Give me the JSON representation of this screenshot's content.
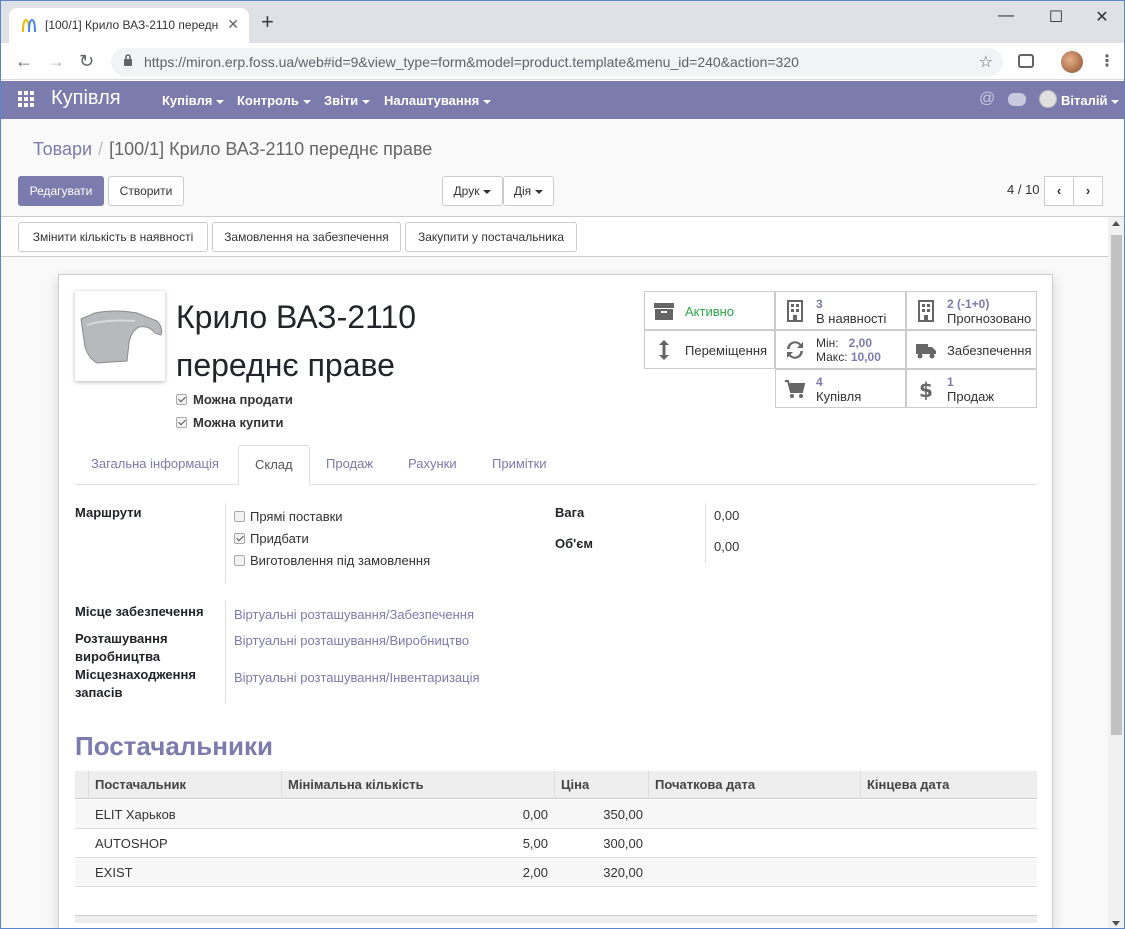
{
  "browser": {
    "tab_title": "[100/1] Крило ВАЗ-2110 передн",
    "url_host": "https://miron.erp.foss.ua",
    "url_path": "/web#id=9&view_type=form&model=product.template&menu_id=240&action=320"
  },
  "navbar": {
    "app_name": "Купівля",
    "menus": [
      "Купівля",
      "Контроль",
      "Звіти",
      "Налаштування"
    ],
    "user": "Віталій"
  },
  "breadcrumb": {
    "parent": "Товари",
    "separator": "/",
    "current": "[100/1] Крило ВАЗ-2110 переднє праве"
  },
  "buttons": {
    "edit": "Редагувати",
    "create": "Створити",
    "print": "Друк",
    "action": "Дія",
    "update_qty": "Змінити кількість в наявності",
    "replenish": "Замовлення на забезпечення",
    "buy_from_vendor": "Закупити у постачальника"
  },
  "pager": {
    "value": "4 / 10"
  },
  "product": {
    "name": "Крило ВАЗ-2110 переднє праве",
    "can_sell_label": "Можна продати",
    "can_buy_label": "Можна купити"
  },
  "smart_buttons": {
    "active": "Активно",
    "on_hand_qty": "3",
    "on_hand_label": "В наявності",
    "forecast_qty": "2 (-1+0)",
    "forecast_label": "Прогнозовано",
    "moves_label": "Переміщення",
    "min_label": "Мін:",
    "min_value": "2,00",
    "max_label": "Макс:",
    "max_value": "10,00",
    "supply_label": "Забезпечення",
    "purchase_count": "4",
    "purchase_label": "Купівля",
    "sales_count": "1",
    "sales_label": "Продаж"
  },
  "tabs": [
    "Загальна інформація",
    "Склад",
    "Продаж",
    "Рахунки",
    "Примітки"
  ],
  "inventory": {
    "routes_label": "Маршрути",
    "routes": [
      {
        "label": "Прямі поставки",
        "checked": false
      },
      {
        "label": "Придбати",
        "checked": true
      },
      {
        "label": "Виготовлення під замовлення",
        "checked": false
      }
    ],
    "weight_label": "Вага",
    "weight": "0,00",
    "volume_label": "Об'єм",
    "volume": "0,00",
    "procurement_location_label": "Місце забезпечення",
    "procurement_location": "Віртуальні розташування/Забезпечення",
    "production_location_label": "Розташування виробництва",
    "production_location": "Віртуальні розташування/Виробництво",
    "inventory_location_label": "Місцезнаходження запасів",
    "inventory_location": "Віртуальні розташування/Інвентаризація"
  },
  "vendors": {
    "title": "Постачальники",
    "columns": [
      "Постачальник",
      "Мінімальна кількість",
      "Ціна",
      "Початкова дата",
      "Кінцева дата"
    ],
    "rows": [
      {
        "vendor": "ELIT Харьков",
        "min_qty": "0,00",
        "price": "350,00",
        "start": "",
        "end": ""
      },
      {
        "vendor": "AUTOSHOP",
        "min_qty": "5,00",
        "price": "300,00",
        "start": "",
        "end": ""
      },
      {
        "vendor": "EXIST",
        "min_qty": "2,00",
        "price": "320,00",
        "start": "",
        "end": ""
      }
    ]
  }
}
